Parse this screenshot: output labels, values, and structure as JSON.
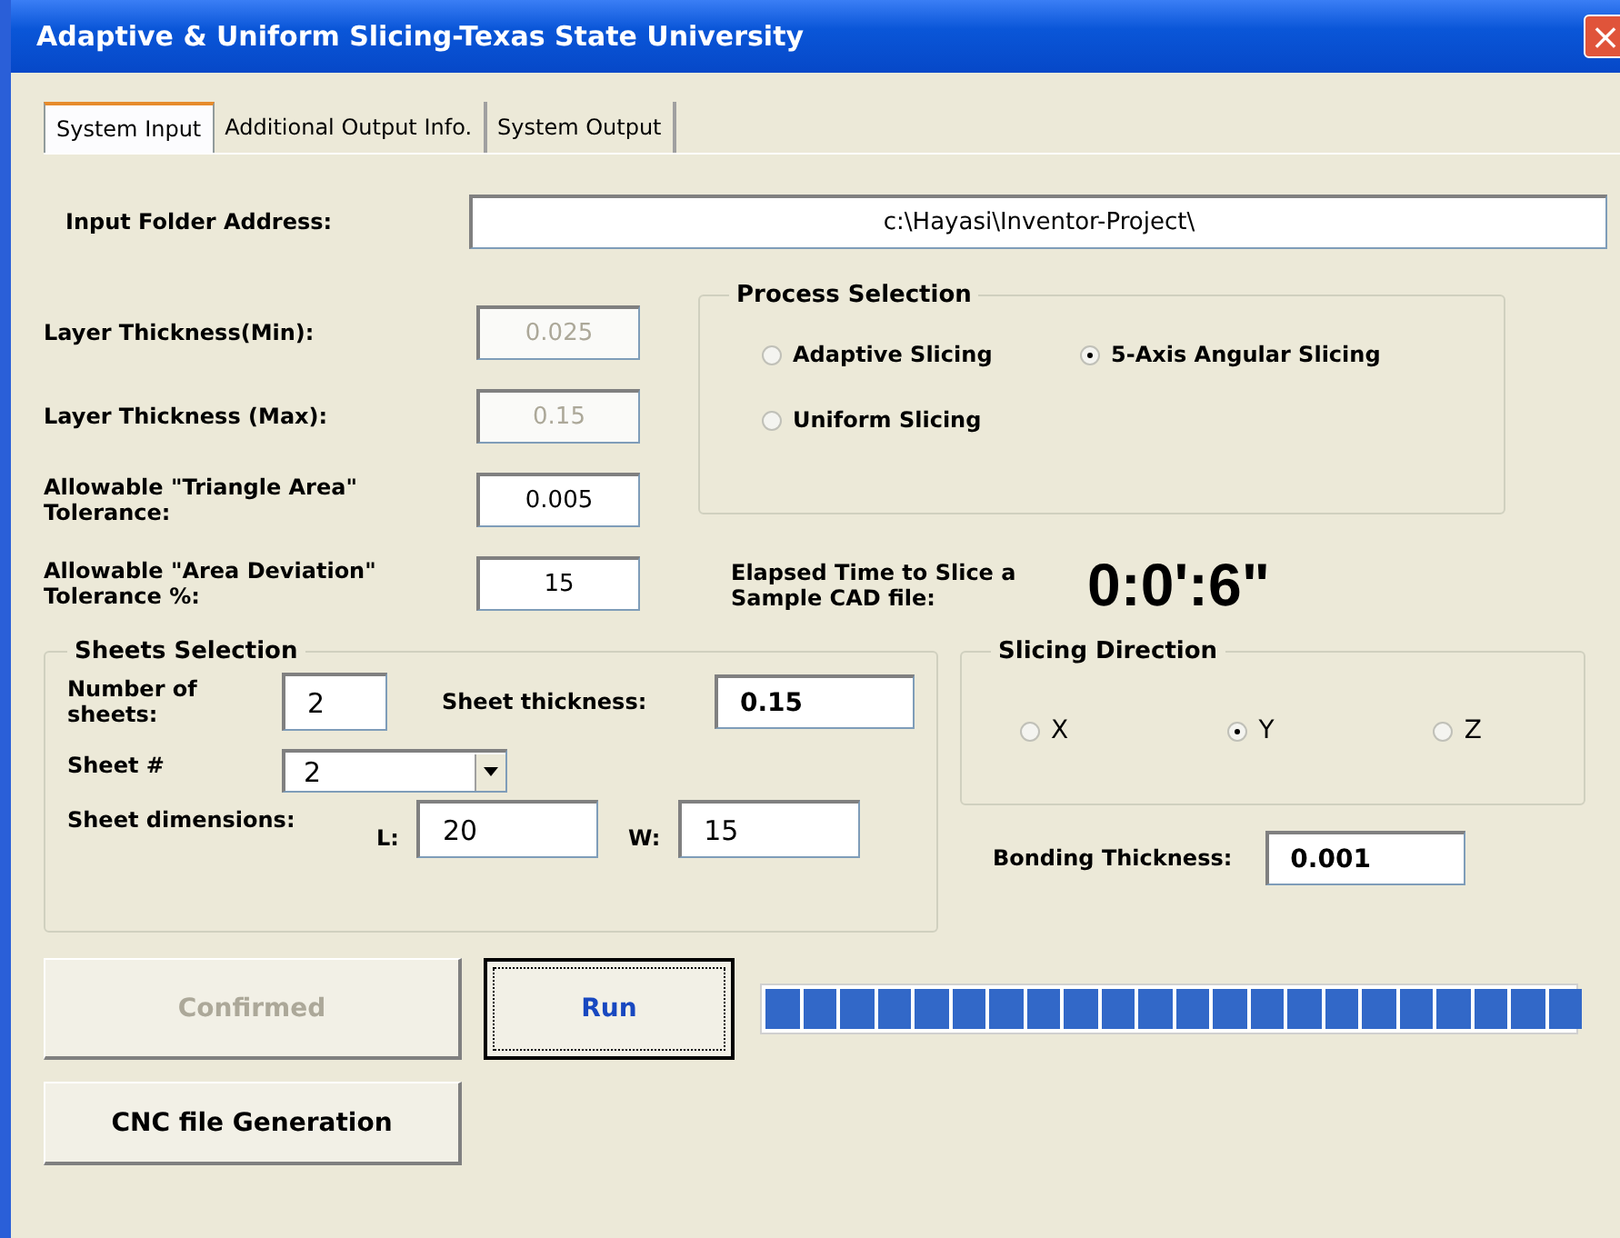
{
  "window": {
    "title": "Adaptive & Uniform Slicing-Texas State University",
    "close": "×"
  },
  "tabs": [
    {
      "label": "System Input",
      "selected": true
    },
    {
      "label": "Additional Output Info.",
      "selected": false
    },
    {
      "label": "System Output",
      "selected": false
    }
  ],
  "input_folder": {
    "label": "Input Folder Address:",
    "value": "c:\\Hayasi\\Inventor-Project\\"
  },
  "parameters": [
    {
      "label": "Layer Thickness(Min):",
      "value": "0.025",
      "disabled": true
    },
    {
      "label": "Layer Thickness (Max):",
      "value": "0.15",
      "disabled": true
    },
    {
      "label": "Allowable \"Triangle Area\" Tolerance:",
      "value": "0.005",
      "disabled": false
    },
    {
      "label": "Allowable \"Area Deviation\" Tolerance %:",
      "value": "15",
      "disabled": false
    }
  ],
  "process_selection": {
    "title": "Process Selection",
    "options": [
      {
        "label": "Adaptive Slicing",
        "selected": false
      },
      {
        "label": "5-Axis Angular Slicing",
        "selected": true
      },
      {
        "label": "Uniform Slicing",
        "selected": false
      }
    ]
  },
  "elapsed": {
    "label": "Elapsed Time to Slice a Sample CAD file:",
    "value": "0:0':6\""
  },
  "sheets": {
    "title": "Sheets Selection",
    "number_label": "Number of sheets:",
    "number_value": "2",
    "thickness_label": "Sheet thickness:",
    "thickness_value": "0.15",
    "sheet_label": "Sheet #",
    "sheet_value": "2",
    "dimensions_label": "Sheet dimensions:",
    "l_label": "L:",
    "l_value": "20",
    "w_label": "W:",
    "w_value": "15"
  },
  "slicing_direction": {
    "title": "Slicing Direction",
    "options": [
      {
        "label": "X",
        "selected": false
      },
      {
        "label": "Y",
        "selected": true
      },
      {
        "label": "Z",
        "selected": false
      }
    ]
  },
  "bonding": {
    "label": "Bonding Thickness:",
    "value": "0.001"
  },
  "buttons": [
    {
      "label": "Confirmed",
      "disabled": true,
      "default": false
    },
    {
      "label": "Run",
      "disabled": false,
      "default": true
    },
    {
      "label": "CNC file Generation",
      "disabled": false,
      "default": false
    }
  ],
  "progress": {
    "level": 1
  }
}
